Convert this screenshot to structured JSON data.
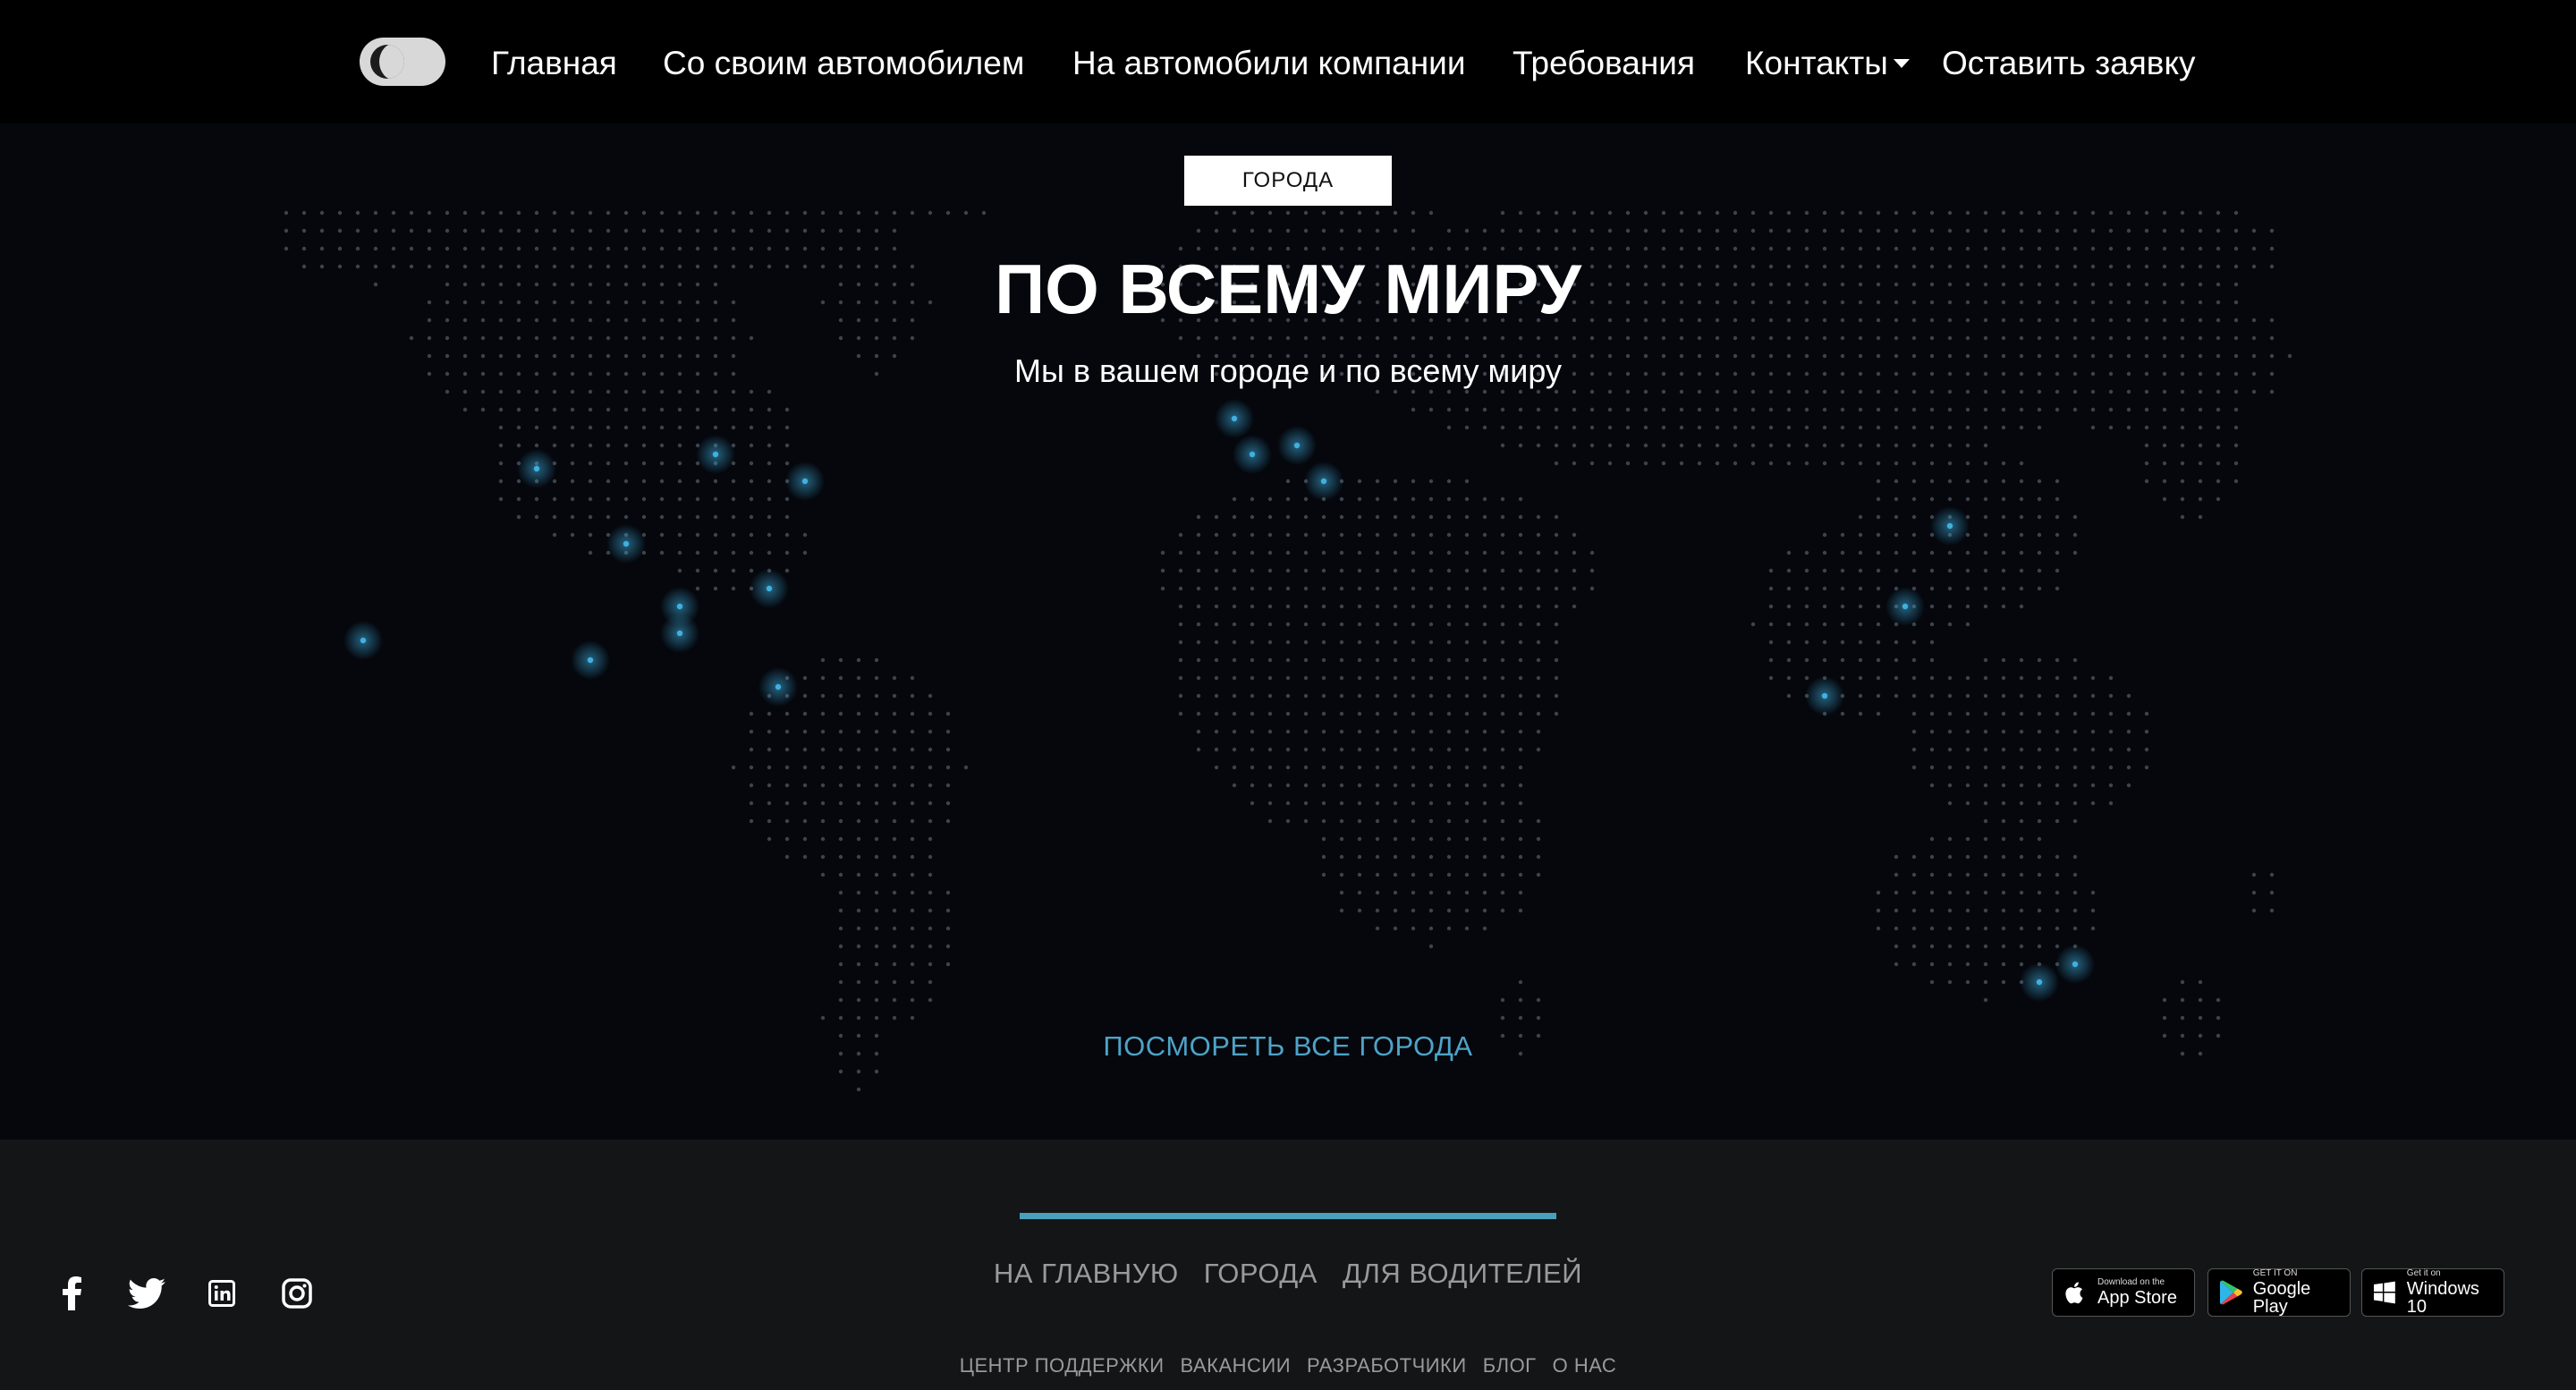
{
  "nav": {
    "theme_toggle": "dark",
    "items": [
      {
        "label": "Главная"
      },
      {
        "label": "Со своим автомобилем"
      },
      {
        "label": "На автомобили компании"
      },
      {
        "label": "Требования"
      },
      {
        "label": "Контакты"
      },
      {
        "label": "Оставить заявку"
      }
    ]
  },
  "hero": {
    "badge": "ГОРОДА",
    "title": "ПО ВСЕМУ МИРУ",
    "subtitle": "Мы в вашем городе и по всему миру",
    "link": "ПОСМОРЕТЬ ВСЕ ГОРОДА"
  },
  "footer": {
    "links": [
      "НА ГЛАВНУЮ",
      "ГОРОДА",
      "ДЛЯ ВОДИТЕЛЕЙ"
    ],
    "secondary_links": [
      "ЦЕНТР ПОДДЕРЖКИ",
      "ВАКАНСИИ",
      "РАЗРАБОТЧИКИ",
      "БЛОГ",
      "О НАС"
    ],
    "social": [
      "facebook-icon",
      "twitter-icon",
      "linkedin-icon",
      "instagram-icon"
    ],
    "stores": [
      {
        "small": "Download on the",
        "big": "App Store"
      },
      {
        "small": "GET IT ON",
        "big": "Google Play"
      },
      {
        "small": "Get it on",
        "big": "Windows 10"
      }
    ]
  },
  "colors": {
    "background": "#05070d",
    "footer": "#141517",
    "accent": "#4ea3c7",
    "dot": "#6e7480",
    "highlight": "#3fb0e0"
  }
}
